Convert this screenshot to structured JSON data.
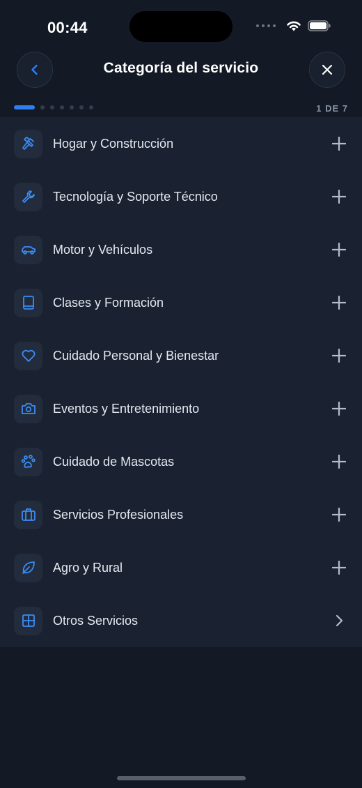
{
  "status_bar": {
    "time": "00:44"
  },
  "header": {
    "title": "Categoría del servicio"
  },
  "progress": {
    "current": 1,
    "total": 7,
    "label": "1 DE 7"
  },
  "categories": [
    {
      "label": "Hogar y Construcción",
      "icon": "hammer-icon",
      "action": "plus-icon"
    },
    {
      "label": "Tecnología y Soporte Técnico",
      "icon": "wrench-icon",
      "action": "plus-icon"
    },
    {
      "label": "Motor y Vehículos",
      "icon": "car-icon",
      "action": "plus-icon"
    },
    {
      "label": "Clases y Formación",
      "icon": "book-icon",
      "action": "plus-icon"
    },
    {
      "label": "Cuidado Personal y Bienestar",
      "icon": "heart-icon",
      "action": "plus-icon"
    },
    {
      "label": "Eventos y Entretenimiento",
      "icon": "camera-icon",
      "action": "plus-icon"
    },
    {
      "label": "Cuidado de Mascotas",
      "icon": "paw-icon",
      "action": "plus-icon"
    },
    {
      "label": "Servicios Profesionales",
      "icon": "briefcase-icon",
      "action": "plus-icon"
    },
    {
      "label": "Agro y Rural",
      "icon": "leaf-icon",
      "action": "plus-icon"
    },
    {
      "label": "Otros Servicios",
      "icon": "grid-icon",
      "action": "chevron-right-icon"
    }
  ],
  "colors": {
    "accent": "#2f7ff0",
    "background": "#131a26",
    "list_background": "#1a2231"
  }
}
